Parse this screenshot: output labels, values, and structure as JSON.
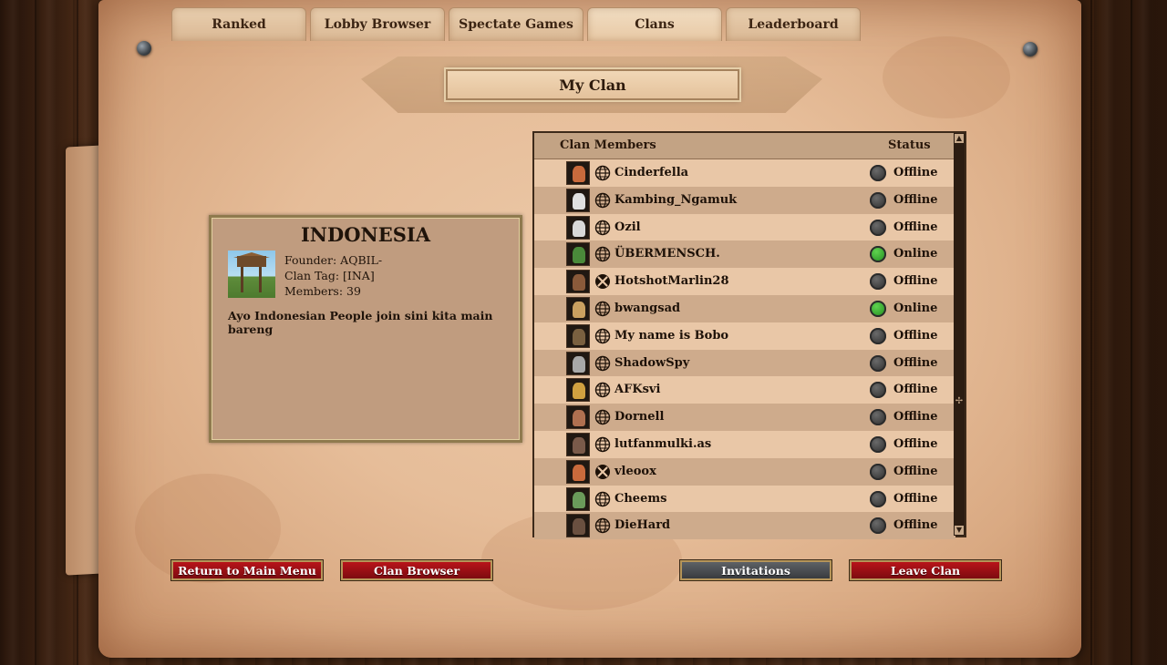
{
  "tabs": [
    {
      "label": "Ranked",
      "active": false
    },
    {
      "label": "Lobby Browser",
      "active": false
    },
    {
      "label": "Spectate Games",
      "active": false
    },
    {
      "label": "Clans",
      "active": true
    },
    {
      "label": "Leaderboard",
      "active": false
    }
  ],
  "page_title": "My Clan",
  "clan": {
    "name": "INDONESIA",
    "founder": "Founder: AQBIL-",
    "tag": "Clan Tag: [INA]",
    "members": "Members: 39",
    "description": "Ayo Indonesian People join sini kita main bareng"
  },
  "members_table": {
    "header_name": "Clan Members",
    "header_status": "Status",
    "rows": [
      {
        "name": "Cinderfella",
        "platform": "globe-icon",
        "status": "Offline"
      },
      {
        "name": "Kambing_Ngamuk",
        "platform": "globe-icon",
        "status": "Offline"
      },
      {
        "name": "Ozil",
        "platform": "globe-icon",
        "status": "Offline"
      },
      {
        "name": "ÜBERMENSCH.",
        "platform": "globe-icon",
        "status": "Online"
      },
      {
        "name": "HotshotMarlin28",
        "platform": "xbox-icon",
        "status": "Offline"
      },
      {
        "name": "bwangsad",
        "platform": "globe-icon",
        "status": "Online"
      },
      {
        "name": "My name is Bobo",
        "platform": "globe-icon",
        "status": "Offline"
      },
      {
        "name": "ShadowSpy",
        "platform": "globe-icon",
        "status": "Offline"
      },
      {
        "name": "AFKsvi",
        "platform": "globe-icon",
        "status": "Offline"
      },
      {
        "name": "Dornell",
        "platform": "globe-icon",
        "status": "Offline"
      },
      {
        "name": "lutfanmulki.as",
        "platform": "globe-icon",
        "status": "Offline"
      },
      {
        "name": "vleoox",
        "platform": "xbox-icon",
        "status": "Offline"
      },
      {
        "name": "Cheems",
        "platform": "globe-icon",
        "status": "Offline"
      },
      {
        "name": "DieHard",
        "platform": "globe-icon",
        "status": "Offline"
      }
    ]
  },
  "buttons": {
    "return": "Return to Main Menu",
    "browser": "Clan Browser",
    "invitations": "Invitations",
    "leave": "Leave Clan"
  },
  "colors": {
    "online": "#2f9a2a",
    "offline": "#3a3a3a",
    "button_red": "#a3121a",
    "button_gray": "#4b4e52"
  }
}
